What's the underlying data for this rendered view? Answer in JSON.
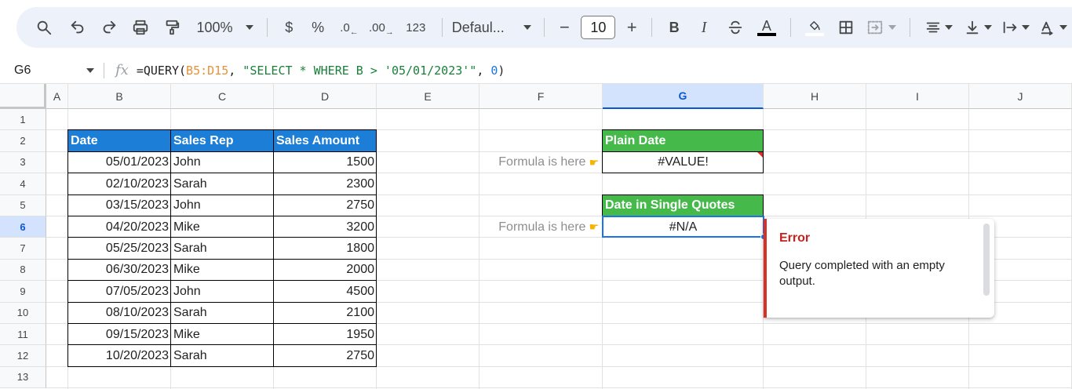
{
  "toolbar": {
    "zoom": "100%",
    "currency": "$",
    "percent": "%",
    "dec_decrease": ".0",
    "dec_increase": ".00",
    "number_format": "123",
    "font_name": "Defaul...",
    "font_size": "10",
    "bold": "B",
    "italic": "I",
    "text_color": "A"
  },
  "formula_bar": {
    "cell_ref": "G6",
    "formula_start": "=QUERY(",
    "formula_range": "B5:D15",
    "formula_sep1": ", ",
    "formula_query": "\"SELECT * WHERE B > '05/01/2023'\"",
    "formula_sep2": ", ",
    "formula_arg": "0",
    "formula_end": ")"
  },
  "columns": [
    "A",
    "B",
    "C",
    "D",
    "E",
    "F",
    "G",
    "H",
    "I",
    "J"
  ],
  "rows": [
    "1",
    "2",
    "3",
    "4",
    "5",
    "6",
    "7",
    "8",
    "9",
    "10",
    "11",
    "12",
    "13"
  ],
  "selected": {
    "column": "G",
    "row": "6"
  },
  "sales_table": {
    "headers": [
      "Date",
      "Sales Rep",
      "Sales Amount"
    ],
    "rows": [
      [
        "05/01/2023",
        "John",
        "1500"
      ],
      [
        "02/10/2023",
        "Sarah",
        "2300"
      ],
      [
        "03/15/2023",
        "John",
        "2750"
      ],
      [
        "04/20/2023",
        "Mike",
        "3200"
      ],
      [
        "05/25/2023",
        "Sarah",
        "1800"
      ],
      [
        "06/30/2023",
        "Mike",
        "2000"
      ],
      [
        "07/05/2023",
        "John",
        "4500"
      ],
      [
        "08/10/2023",
        "Sarah",
        "2100"
      ],
      [
        "09/15/2023",
        "Mike",
        "1950"
      ],
      [
        "10/20/2023",
        "Sarah",
        "2750"
      ]
    ]
  },
  "results": {
    "plain_header": "Plain Date",
    "plain_value": "#VALUE!",
    "quotes_header": "Date in Single Quotes",
    "quotes_value": "#N/A"
  },
  "notes": {
    "note1": "Formula is here",
    "note2": "Formula is here"
  },
  "error_popup": {
    "title": "Error",
    "message": "Query completed with an empty output."
  },
  "colors": {
    "blue_header": "#1c7ed6",
    "green_header": "#45b94a",
    "error_red": "#d93025",
    "selection_blue": "#1a73e8"
  }
}
